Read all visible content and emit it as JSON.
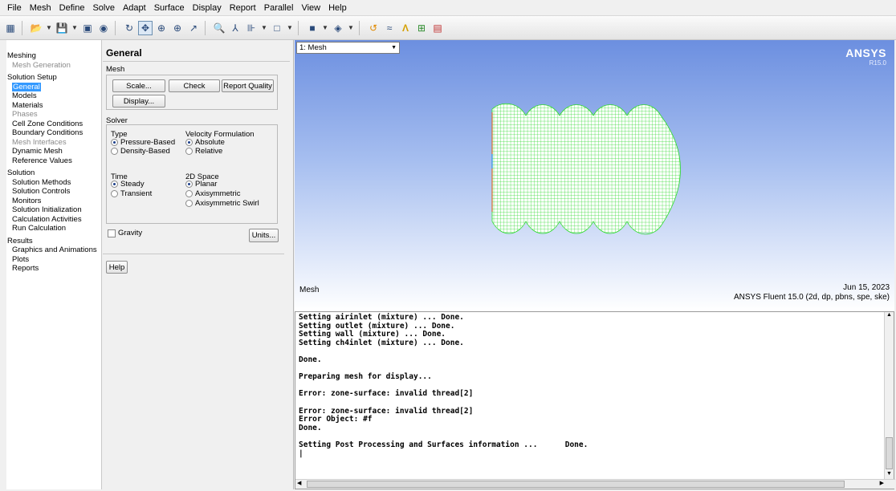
{
  "menu": [
    "File",
    "Mesh",
    "Define",
    "Solve",
    "Adapt",
    "Surface",
    "Display",
    "Report",
    "Parallel",
    "View",
    "Help"
  ],
  "toolbar_icons": [
    "layout-icon",
    "open-icon",
    "save-icon",
    "image-icon",
    "help-icon",
    "rotate-icon",
    "translate-icon",
    "zoom-icon",
    "zoom-box-icon",
    "probe-icon",
    "zoom-fit-icon",
    "mesh-outline-icon",
    "bars-icon",
    "frame-icon",
    "square-icon",
    "view-icon",
    "lights-icon",
    "refresh-icon",
    "ansys-logo-icon",
    "mesh-icon",
    "grid-icon"
  ],
  "tree": {
    "items": [
      {
        "label": "Meshing",
        "kind": "cat"
      },
      {
        "label": "Mesh Generation",
        "kind": "dis"
      },
      {
        "label": "Solution Setup",
        "kind": "cat"
      },
      {
        "label": "General",
        "kind": "sel"
      },
      {
        "label": "Models",
        "kind": "item"
      },
      {
        "label": "Materials",
        "kind": "item"
      },
      {
        "label": "Phases",
        "kind": "dis"
      },
      {
        "label": "Cell Zone Conditions",
        "kind": "item"
      },
      {
        "label": "Boundary Conditions",
        "kind": "item"
      },
      {
        "label": "Mesh Interfaces",
        "kind": "dis"
      },
      {
        "label": "Dynamic Mesh",
        "kind": "item"
      },
      {
        "label": "Reference Values",
        "kind": "item"
      },
      {
        "label": "Solution",
        "kind": "cat"
      },
      {
        "label": "Solution Methods",
        "kind": "item"
      },
      {
        "label": "Solution Controls",
        "kind": "item"
      },
      {
        "label": "Monitors",
        "kind": "item"
      },
      {
        "label": "Solution Initialization",
        "kind": "item"
      },
      {
        "label": "Calculation Activities",
        "kind": "item"
      },
      {
        "label": "Run Calculation",
        "kind": "item"
      },
      {
        "label": "Results",
        "kind": "cat"
      },
      {
        "label": "Graphics and Animations",
        "kind": "item"
      },
      {
        "label": "Plots",
        "kind": "item"
      },
      {
        "label": "Reports",
        "kind": "item"
      }
    ]
  },
  "panel": {
    "title": "General",
    "mesh_group": "Mesh",
    "scale": "Scale...",
    "check": "Check",
    "report_quality": "Report Quality",
    "display": "Display...",
    "solver_group": "Solver",
    "type_label": "Type",
    "pressure_based": "Pressure-Based",
    "density_based": "Density-Based",
    "velocity_label": "Velocity Formulation",
    "absolute": "Absolute",
    "relative": "Relative",
    "time_label": "Time",
    "steady": "Steady",
    "transient": "Transient",
    "space_label": "2D Space",
    "planar": "Planar",
    "axisymmetric": "Axisymmetric",
    "axisymmetric_swirl": "Axisymmetric Swirl",
    "gravity": "Gravity",
    "units": "Units...",
    "help": "Help"
  },
  "graphics": {
    "view": "1: Mesh",
    "brand": "ANSYS",
    "version": "R15.0",
    "title": "Mesh",
    "date": "Jun 15, 2023",
    "product": "ANSYS Fluent 15.0 (2d, dp, pbns, spe, ske)",
    "mesh_color": "#33ee33",
    "background_top": "#6c8fe0"
  },
  "console": {
    "text": "Setting airinlet (mixture) ... Done.\nSetting outlet (mixture) ... Done.\nSetting wall (mixture) ... Done.\nSetting ch4inlet (mixture) ... Done.\n\nDone.\n\nPreparing mesh for display...\n\nError: zone-surface: invalid thread[2]\n\nError: zone-surface: invalid thread[2]\nError Object: #f\nDone.\n\nSetting Post Processing and Surfaces information ...      Done.\n|"
  }
}
